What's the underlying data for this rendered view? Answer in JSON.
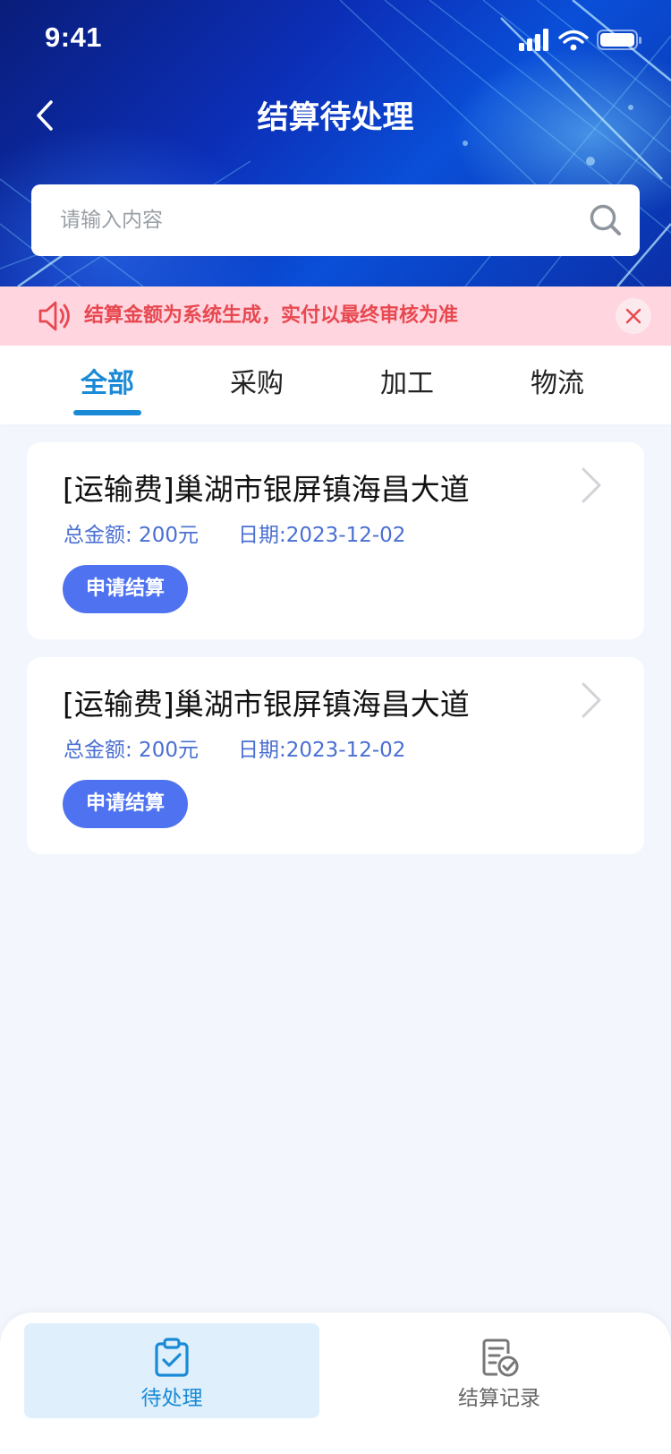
{
  "status_bar": {
    "time": "9:41"
  },
  "nav": {
    "title": "结算待处理"
  },
  "search": {
    "placeholder": "请输入内容"
  },
  "notice": {
    "text": "结算金额为系统生成，实付以最终审核为准"
  },
  "tabs": [
    {
      "label": "全部",
      "active": true
    },
    {
      "label": "采购",
      "active": false
    },
    {
      "label": "加工",
      "active": false
    },
    {
      "label": "物流",
      "active": false
    }
  ],
  "cards": [
    {
      "title": "[运输费]巢湖市银屏镇海昌大道",
      "amount": "总金额: 200元",
      "date": "日期:2023-12-02",
      "button": "申请结算"
    },
    {
      "title": "[运输费]巢湖市银屏镇海昌大道",
      "amount": "总金额: 200元",
      "date": "日期:2023-12-02",
      "button": "申请结算"
    }
  ],
  "tabbar": [
    {
      "label": "待处理",
      "icon": "clipboard-check-icon",
      "active": true
    },
    {
      "label": "结算记录",
      "icon": "document-check-icon",
      "active": false
    }
  ],
  "colors": {
    "accent": "#1a8ad6",
    "button": "#4f73f0",
    "notice_text": "#e8484f",
    "notice_bg": "#ffd5e0",
    "meta_text": "#4a6fd2"
  }
}
